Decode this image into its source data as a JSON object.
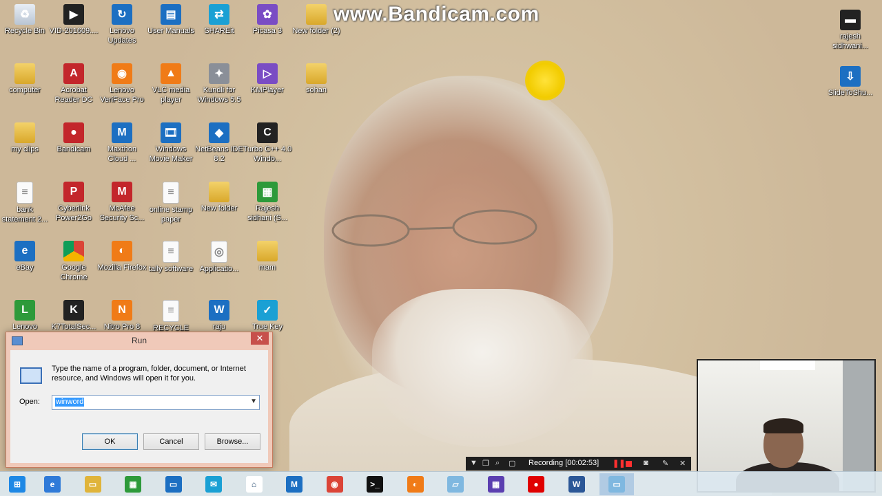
{
  "watermark": "www.Bandicam.com",
  "desktop_icons": [
    {
      "label": "Recycle Bin",
      "icon": "recycle-bin-icon"
    },
    {
      "label": "VID-201609....",
      "icon": "video-file-icon"
    },
    {
      "label": "Lenovo Updates",
      "icon": "lenovo-updates-icon"
    },
    {
      "label": "User Manuals",
      "icon": "user-manuals-icon"
    },
    {
      "label": "SHAREit",
      "icon": "shareit-icon"
    },
    {
      "label": "Picasa 3",
      "icon": "picasa-icon"
    },
    {
      "label": "New folder (2)",
      "icon": "folder-icon"
    },
    {
      "label": "computer",
      "icon": "folder-icon"
    },
    {
      "label": "Acrobat Reader DC",
      "icon": "acrobat-icon"
    },
    {
      "label": "Lenovo VeriFace Pro",
      "icon": "veriface-icon"
    },
    {
      "label": "VLC media player",
      "icon": "vlc-icon"
    },
    {
      "label": "Kundli for Windows 5.5",
      "icon": "kundli-icon"
    },
    {
      "label": "KMPlayer",
      "icon": "kmplayer-icon"
    },
    {
      "label": "sohan",
      "icon": "folder-icon"
    },
    {
      "label": "my clips",
      "icon": "folder-icon"
    },
    {
      "label": "Bandicam",
      "icon": "bandicam-icon"
    },
    {
      "label": "Maxthon Cloud ...",
      "icon": "maxthon-icon"
    },
    {
      "label": "Windows Movie Maker",
      "icon": "movie-maker-icon"
    },
    {
      "label": "NetBeans IDE 8.2",
      "icon": "netbeans-icon"
    },
    {
      "label": "Turbo C++ 4.0 Windo...",
      "icon": "turbo-cpp-icon"
    },
    {
      "label": "bank statement 2...",
      "icon": "document-icon"
    },
    {
      "label": "Cyberlink Power2Go",
      "icon": "power2go-icon"
    },
    {
      "label": "McAfee Security Sc...",
      "icon": "mcafee-icon"
    },
    {
      "label": "online stamp paper",
      "icon": "document-icon"
    },
    {
      "label": "New folder",
      "icon": "folder-icon"
    },
    {
      "label": "Rajesh sidhani (S...",
      "icon": "rajesh-sidhani-icon"
    },
    {
      "label": "eBay",
      "icon": "ebay-icon"
    },
    {
      "label": "Google Chrome",
      "icon": "chrome-icon"
    },
    {
      "label": "Mozilla Firefox",
      "icon": "firefox-icon"
    },
    {
      "label": "tally software",
      "icon": "document-icon"
    },
    {
      "label": "Applicatio...",
      "icon": "application-icon"
    },
    {
      "label": "mam",
      "icon": "folder-icon"
    },
    {
      "label": "Lenovo",
      "icon": "lenovo-icon"
    },
    {
      "label": "K7TotalSec...",
      "icon": "k7-icon"
    },
    {
      "label": "Nitro Pro 8",
      "icon": "nitro-icon"
    },
    {
      "label": "RECYCLE BIN",
      "icon": "document-icon"
    },
    {
      "label": "raju",
      "icon": "word-doc-icon"
    },
    {
      "label": "True Key",
      "icon": "truekey-icon"
    },
    {
      "label": "rajesh sidhwani...",
      "icon": "rajesh-sidhwani-icon"
    },
    {
      "label": "SlideToShu...",
      "icon": "slide-to-shutdown-icon"
    }
  ],
  "run_dialog": {
    "title": "Run",
    "close": "✕",
    "description": "Type the name of a program, folder, document, or Internet resource, and Windows will open it for you.",
    "open_label": "Open:",
    "open_value": "winword",
    "ok": "OK",
    "cancel": "Cancel",
    "browse": "Browse..."
  },
  "recording_toolbar": {
    "status": "Recording [00:02:53]"
  },
  "taskbar": {
    "items": [
      {
        "name": "start-button",
        "icon": "windows-logo-icon",
        "active": false
      },
      {
        "name": "ie",
        "icon": "internet-explorer-icon",
        "active": false
      },
      {
        "name": "explorer",
        "icon": "file-explorer-icon",
        "active": false
      },
      {
        "name": "store",
        "icon": "store-icon",
        "active": false
      },
      {
        "name": "lenovo",
        "icon": "lenovo-icon",
        "active": false
      },
      {
        "name": "mail",
        "icon": "mail-icon",
        "active": false
      },
      {
        "name": "home",
        "icon": "home-icon",
        "active": false
      },
      {
        "name": "maxthon",
        "icon": "maxthon-icon",
        "active": false
      },
      {
        "name": "chrome",
        "icon": "chrome-icon",
        "active": false
      },
      {
        "name": "cmd",
        "icon": "command-prompt-icon",
        "active": false
      },
      {
        "name": "firefox",
        "icon": "firefox-icon",
        "active": false
      },
      {
        "name": "slide",
        "icon": "slide-icon",
        "active": false
      },
      {
        "name": "calendar",
        "icon": "calendar-icon",
        "active": false
      },
      {
        "name": "bandicam",
        "icon": "record-icon",
        "active": false
      },
      {
        "name": "word",
        "icon": "word-icon",
        "active": false
      },
      {
        "name": "run",
        "icon": "run-icon",
        "active": true
      }
    ]
  },
  "colors": {
    "accent": "#3399ff",
    "dialog_frame": "#f0c9b9",
    "close_button": "#c7504b",
    "record_red": "#ff3030"
  }
}
